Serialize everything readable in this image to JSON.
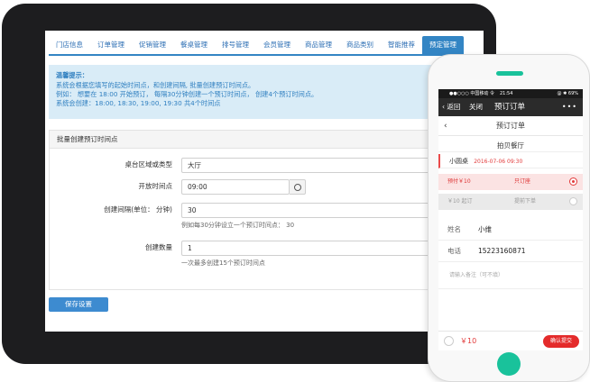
{
  "tabs": [
    {
      "label": "门店信息",
      "active": false
    },
    {
      "label": "订单管理",
      "active": false
    },
    {
      "label": "促销管理",
      "active": false
    },
    {
      "label": "餐桌管理",
      "active": false
    },
    {
      "label": "排号管理",
      "active": false
    },
    {
      "label": "会员管理",
      "active": false
    },
    {
      "label": "商品管理",
      "active": false
    },
    {
      "label": "商品类别",
      "active": false
    },
    {
      "label": "智能推荐",
      "active": false
    },
    {
      "label": "预定管理",
      "active": true
    }
  ],
  "notice": {
    "title": "温馨提示：",
    "lines": [
      "系统会根据您填写的起始时间点，和创建间隔, 批量创建预订时间点。",
      "例如：  想要在 18:00 开始预订，  每隔30分钟创建一个预订时间点，  创建4个预订时间点。",
      "系统会创建：18:00, 18:30, 19:00, 19:30 共4个时间点"
    ]
  },
  "form": {
    "panel_title": "批量创建预订时间点",
    "area_label": "桌台区域或类型",
    "area_value": "大厅",
    "open_time_label": "开放时间点",
    "open_time_value": "09:00",
    "interval_label": "创建间隔(单位： 分钟)",
    "interval_value": "30",
    "interval_help": "例如每30分钟设立一个预订时间点： 30",
    "count_label": "创建数量",
    "count_value": "1",
    "count_help": "一次最多创建15个预订时间点",
    "save_label": "保存设置"
  },
  "phone": {
    "status": {
      "carrier": "●●○○○ 中国移动 令",
      "time": "21:54",
      "battery": "@ ✱ 69%"
    },
    "nav": {
      "back": "返回",
      "close": "关闭",
      "title": "预订订单",
      "more": "•••"
    },
    "subtitle": "预订订单",
    "restaurant": "拍贝餐厅",
    "table": {
      "name": "小圆桌",
      "date": "2016-07-06 09:30"
    },
    "options": [
      {
        "price": "预付￥10",
        "desc": "只订座",
        "selected": true
      },
      {
        "price": "￥10 起订",
        "desc": "提前下单",
        "selected": false
      }
    ],
    "name_label": "姓名",
    "name_value": "小维",
    "phone_label": "电话",
    "phone_value": "15223160871",
    "note_placeholder": "请输入备注（可不填）",
    "total": "￥10",
    "confirm_label": "确认提交"
  },
  "colors": {
    "tab_active": "#3385c4",
    "notice_bg": "#d9ecf7",
    "accent_red": "#e42b2b",
    "phone_accent": "#19c29b"
  }
}
